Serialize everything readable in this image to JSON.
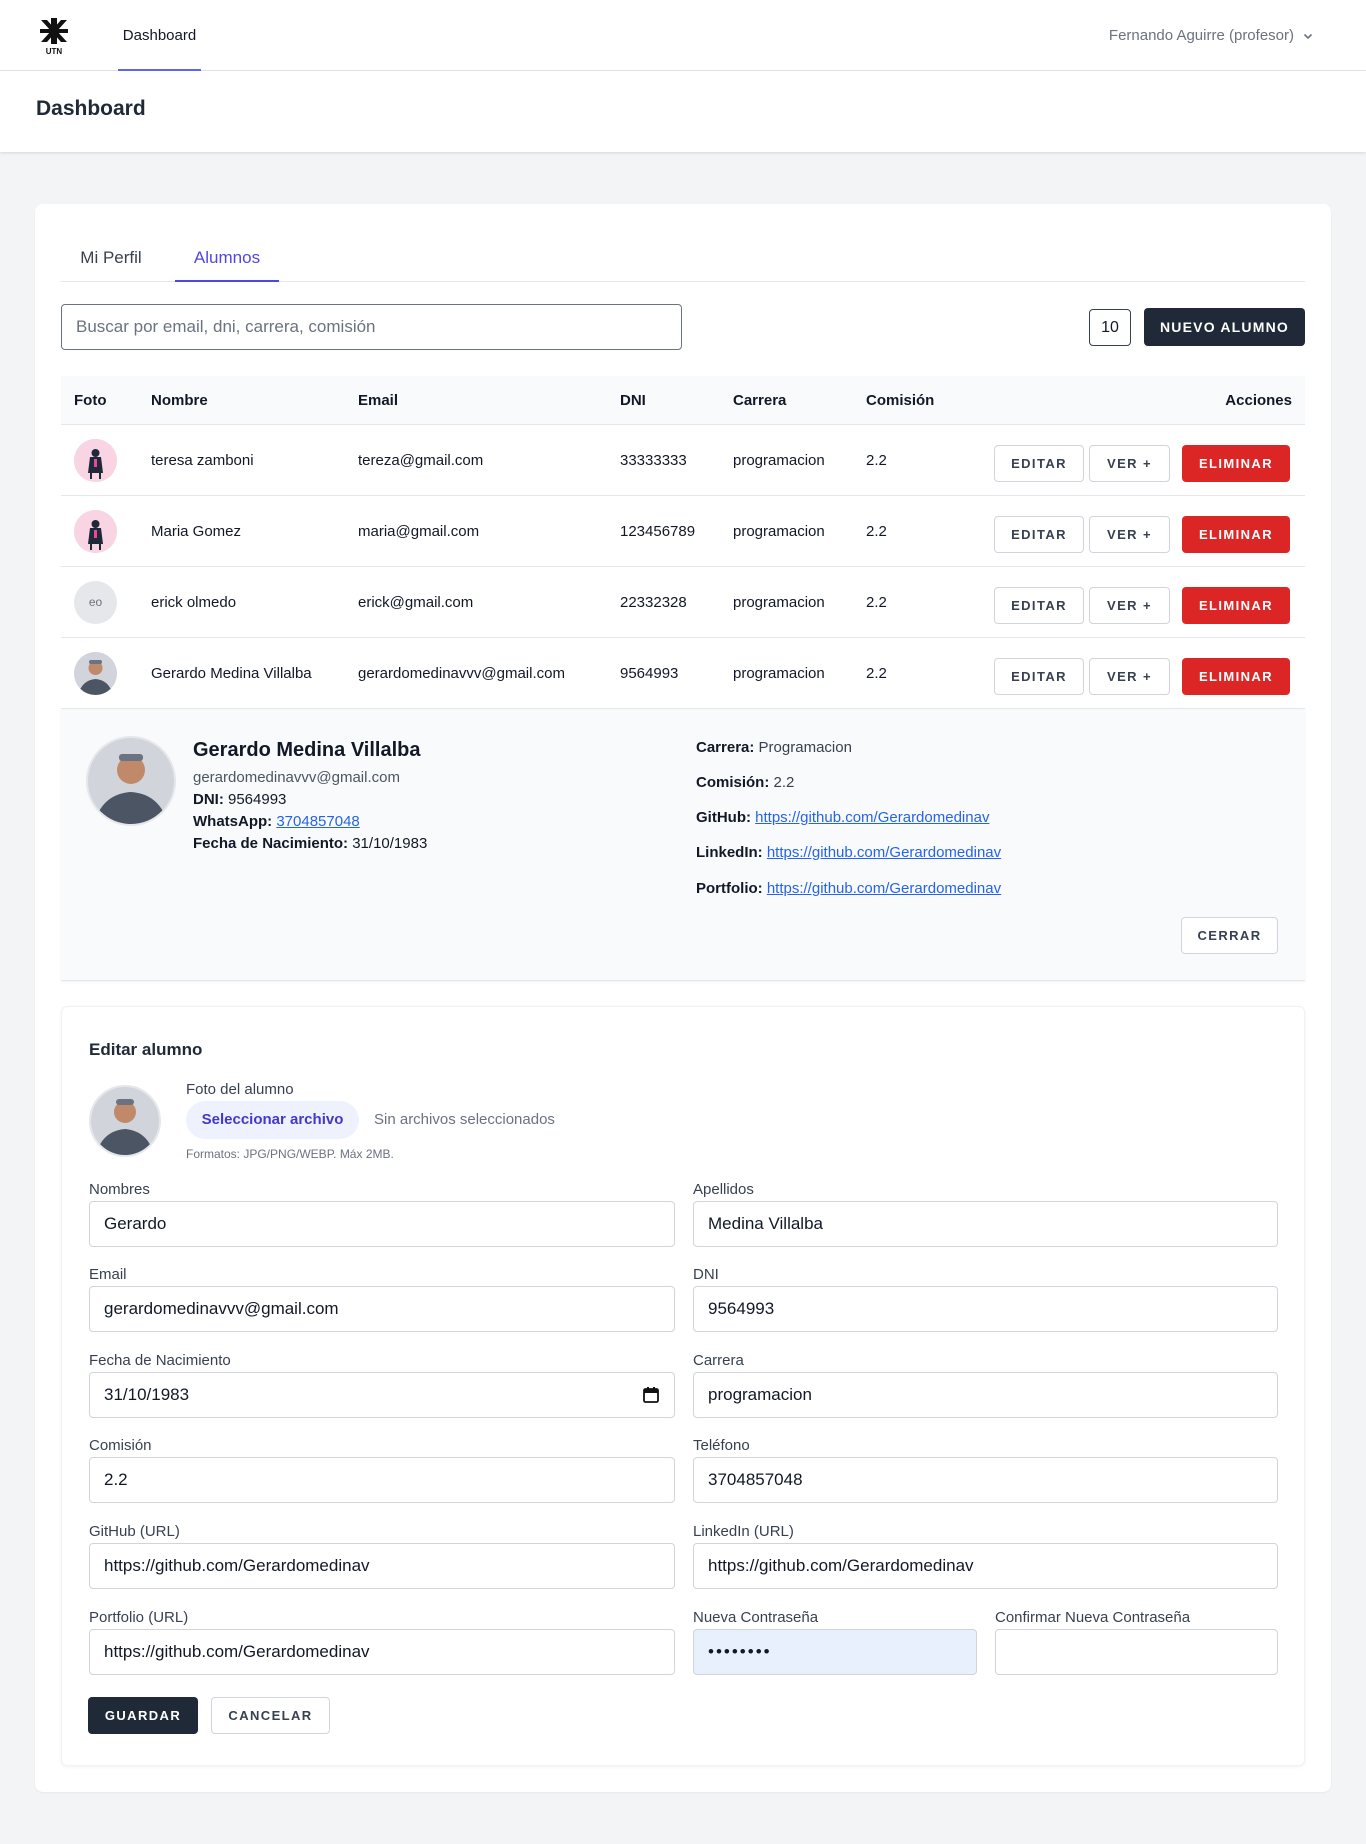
{
  "nav": {
    "logo_alt": "UTN",
    "link": "Dashboard",
    "user": "Fernando Aguirre (profesor)"
  },
  "header": {
    "title": "Dashboard"
  },
  "tabs": [
    "Mi Perfil",
    "Alumnos"
  ],
  "toolbar": {
    "search_placeholder": "Buscar por email, dni, carrera, comisión",
    "per_page": "10",
    "new_button": "NUEVO ALUMNO"
  },
  "table": {
    "headers": [
      "Foto",
      "Nombre",
      "Email",
      "DNI",
      "Carrera",
      "Comisión",
      "Acciones"
    ],
    "rows": [
      {
        "avatar": "illustration",
        "nombre": "teresa zamboni",
        "email": "tereza@gmail.com",
        "dni": "33333333",
        "carrera": "programacion",
        "comision": "2.2"
      },
      {
        "avatar": "illustration",
        "nombre": "Maria Gomez",
        "email": "maria@gmail.com",
        "dni": "123456789",
        "carrera": "programacion",
        "comision": "2.2"
      },
      {
        "avatar": "eo",
        "nombre": "erick olmedo",
        "email": "erick@gmail.com",
        "dni": "22332328",
        "carrera": "programacion",
        "comision": "2.2"
      },
      {
        "avatar": "photo",
        "nombre": "Gerardo Medina Villalba",
        "email": "gerardomedinavvv@gmail.com",
        "dni": "9564993",
        "carrera": "programacion",
        "comision": "2.2"
      }
    ],
    "actions": {
      "edit": "EDITAR",
      "view": "VER +",
      "delete": "ELIMINAR"
    }
  },
  "detail": {
    "name": "Gerardo Medina Villalba",
    "email": "gerardomedinavvv@gmail.com",
    "dni_label": "DNI:",
    "dni": "9564993",
    "whatsapp_label": "WhatsApp:",
    "whatsapp": "3704857048",
    "birth_label": "Fecha de Nacimiento:",
    "birth": "31/10/1983",
    "carrera_label": "Carrera:",
    "carrera": "Programacion",
    "comision_label": "Comisión:",
    "comision": "2.2",
    "github_label": "GitHub:",
    "github": "https://github.com/Gerardomedinav",
    "linkedin_label": "LinkedIn:",
    "linkedin": "https://github.com/Gerardomedinav",
    "portfolio_label": "Portfolio:",
    "portfolio": "https://github.com/Gerardomedinav",
    "close": "CERRAR"
  },
  "edit": {
    "title": "Editar alumno",
    "photo_label": "Foto del alumno",
    "file_button": "Seleccionar archivo",
    "file_status": "Sin archivos seleccionados",
    "file_hint": "Formatos: JPG/PNG/WEBP. Máx 2MB.",
    "fields": {
      "nombres": {
        "label": "Nombres",
        "value": "Gerardo"
      },
      "apellidos": {
        "label": "Apellidos",
        "value": "Medina Villalba"
      },
      "email": {
        "label": "Email",
        "value": "gerardomedinavvv@gmail.com"
      },
      "dni": {
        "label": "DNI",
        "value": "9564993"
      },
      "fecha": {
        "label": "Fecha de Nacimiento",
        "value": "31/10/1983"
      },
      "carrera": {
        "label": "Carrera",
        "value": "programacion"
      },
      "comision": {
        "label": "Comisión",
        "value": "2.2"
      },
      "telefono": {
        "label": "Teléfono",
        "value": "3704857048"
      },
      "github": {
        "label": "GitHub (URL)",
        "value": "https://github.com/Gerardomedinav"
      },
      "linkedin": {
        "label": "LinkedIn (URL)",
        "value": "https://github.com/Gerardomedinav"
      },
      "portfolio": {
        "label": "Portfolio (URL)",
        "value": "https://github.com/Gerardomedinav"
      },
      "password": {
        "label": "Nueva Contraseña",
        "value": "••••••••"
      },
      "confirm": {
        "label": "Confirmar Nueva Contraseña",
        "value": ""
      }
    },
    "save": "GUARDAR",
    "cancel": "CANCELAR"
  },
  "colors": {
    "accent": "#4f46e5",
    "primary_dark": "#1f2937",
    "danger": "#dc2626",
    "link": "#2563eb"
  }
}
